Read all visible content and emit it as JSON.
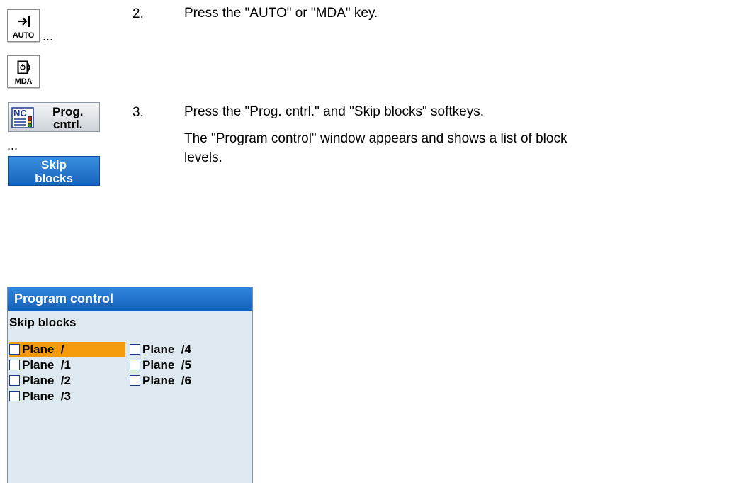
{
  "keys": {
    "auto": {
      "label": "AUTO"
    },
    "mda": {
      "label": "MDA"
    },
    "ellipsis": "..."
  },
  "steps": [
    {
      "number": "2.",
      "text": "Press the \"AUTO\" or \"MDA\" key."
    },
    {
      "number": "3.",
      "text": "Press the \"Prog. cntrl.\" and \"Skip blocks\" softkeys.",
      "text2": "The \"Program control\" window appears and shows a list of block",
      "text3": "levels."
    }
  ],
  "softkeys": {
    "prog_cntrl": {
      "icon_label": "NC",
      "line1": "Prog.",
      "line2": "cntrl."
    },
    "skip_blocks": {
      "line1": "Skip",
      "line2": "blocks"
    },
    "ellipsis": "..."
  },
  "window": {
    "title": "Program control",
    "subtitle": "Skip blocks",
    "options": [
      {
        "label": "Plane  /",
        "checked": false,
        "selected": true
      },
      {
        "label": "Plane  /1",
        "checked": false,
        "selected": false
      },
      {
        "label": "Plane  /2",
        "checked": false,
        "selected": false
      },
      {
        "label": "Plane  /3",
        "checked": false,
        "selected": false
      },
      {
        "label": "Plane  /4",
        "checked": false,
        "selected": false
      },
      {
        "label": "Plane  /5",
        "checked": false,
        "selected": false
      },
      {
        "label": "Plane  /6",
        "checked": false,
        "selected": false
      }
    ]
  },
  "colors": {
    "accent_blue": "#1664bd",
    "selection_orange": "#f59a0a",
    "window_bg": "#dde8ef"
  }
}
